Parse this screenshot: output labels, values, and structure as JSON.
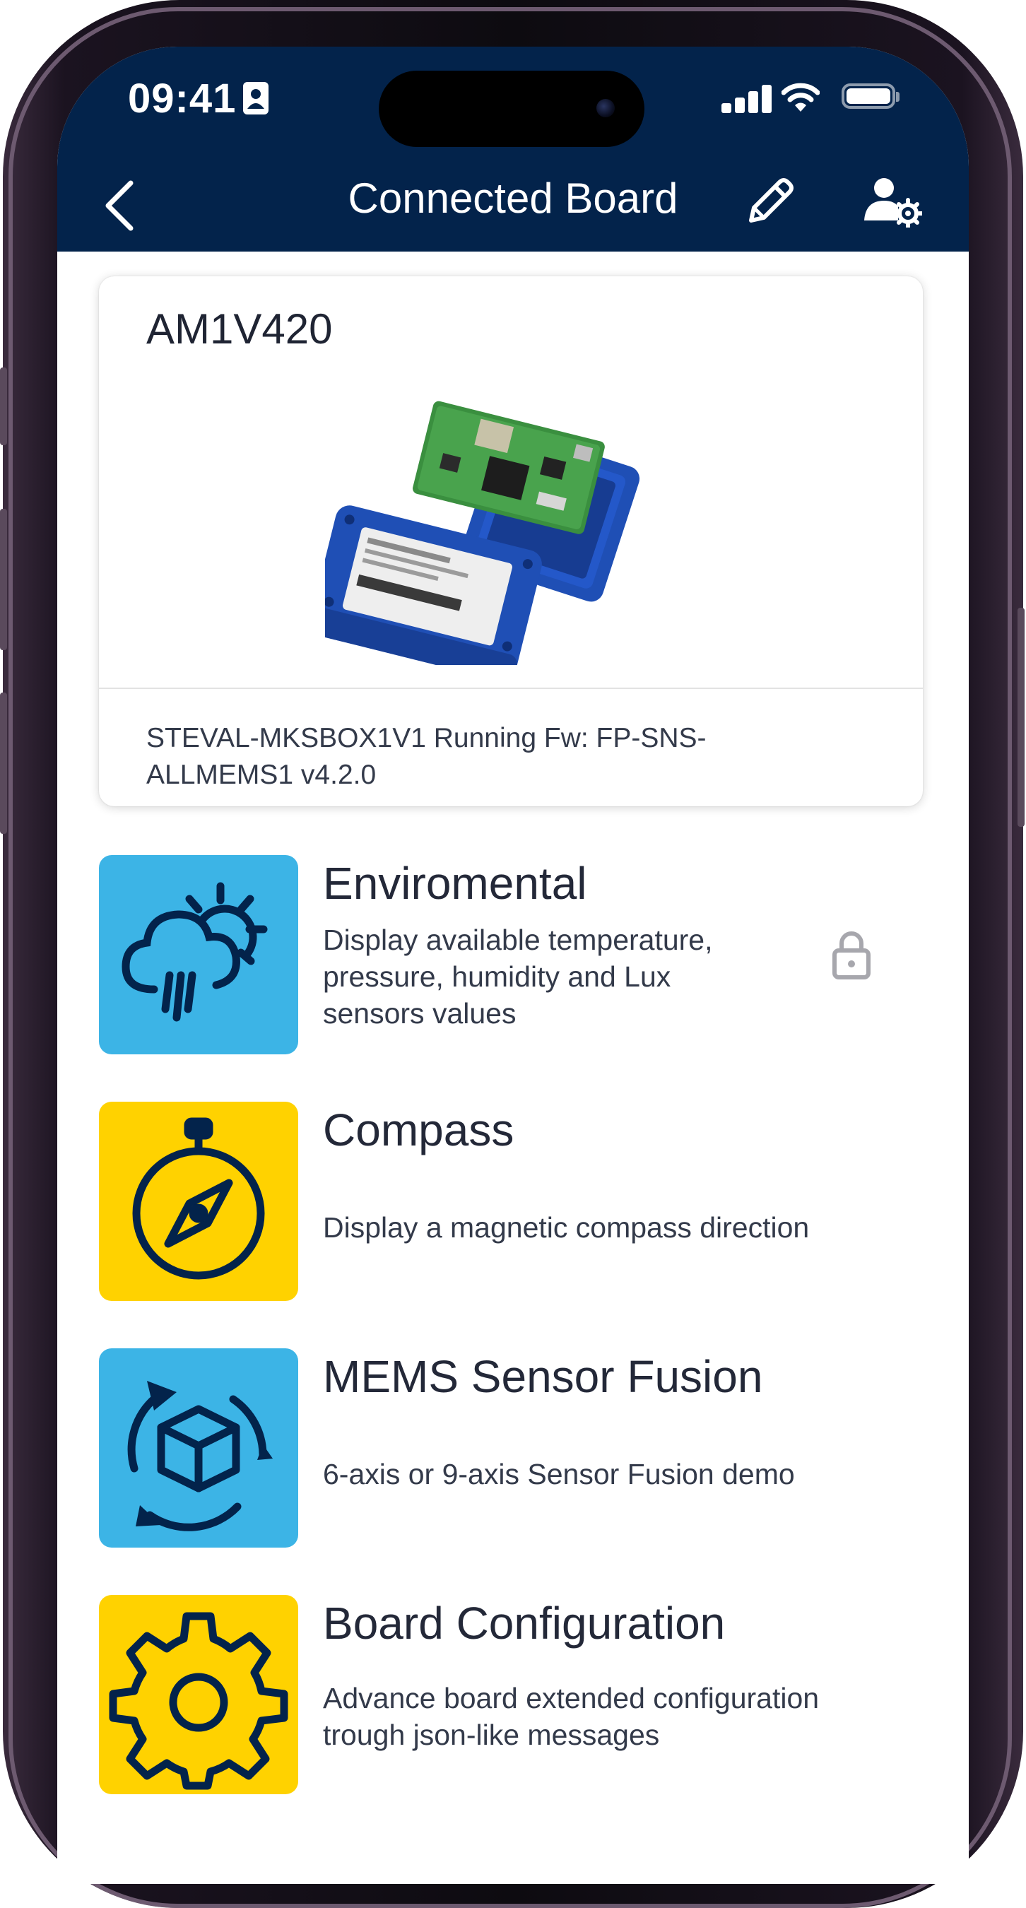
{
  "status_bar": {
    "time": "09:41"
  },
  "header": {
    "title": "Connected Board"
  },
  "board": {
    "name": "AM1V420",
    "description": "STEVAL-MKSBOX1V1 Running Fw: FP-SNS-ALLMEMS1 v4.2.0"
  },
  "demos": [
    {
      "title": "Enviromental",
      "description": "Display available temperature, pressure, humidity and Lux sensors values",
      "icon": "weather-icon",
      "locked": true
    },
    {
      "title": "Compass",
      "description": "Display a magnetic compass direction",
      "icon": "compass-icon",
      "locked": false
    },
    {
      "title": "MEMS Sensor Fusion",
      "description": "6-axis or 9-axis Sensor Fusion demo",
      "icon": "cube-rotate-icon",
      "locked": false
    },
    {
      "title": "Board Configuration",
      "description": "Advance board extended configuration trough json-like messages",
      "icon": "gear-icon",
      "locked": false
    }
  ],
  "colors": {
    "header": "#03234b",
    "tile_blue": "#3cb4e6",
    "tile_yellow": "#ffd200",
    "icon_dark": "#03234b"
  }
}
